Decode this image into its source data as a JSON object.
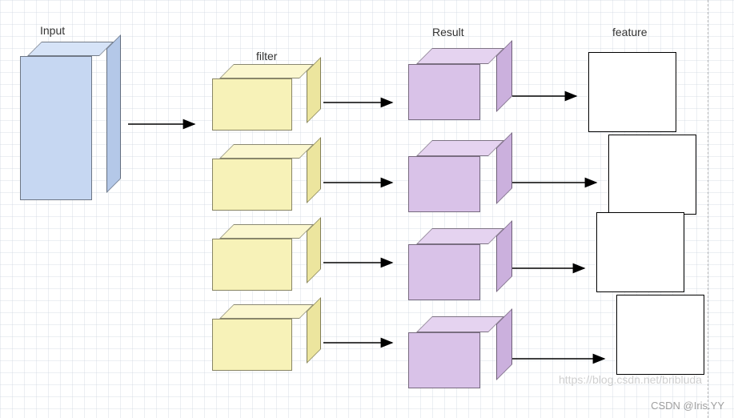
{
  "labels": {
    "input": "Input",
    "filter": "filter",
    "result": "Result",
    "feature": "feature"
  },
  "watermark_url": "https://blog.csdn.net/bribluda",
  "watermark_credit": "CSDN @Iris.YY",
  "colors": {
    "input": "#c6d7f2",
    "filter": "#f7f2b8",
    "result": "#d9c2e8",
    "feature": "#ffffff"
  },
  "stages": [
    "Input",
    "filter",
    "Result",
    "feature"
  ],
  "counts": {
    "input": 1,
    "filter": 4,
    "result": 4,
    "feature": 4
  }
}
